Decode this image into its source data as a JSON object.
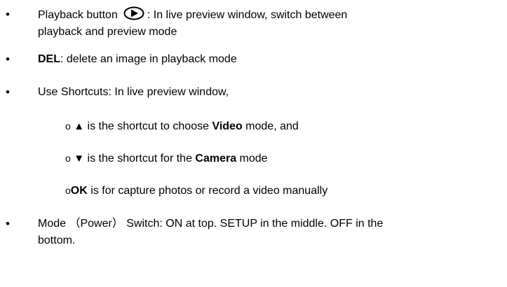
{
  "bullet_char": "•",
  "sub_marker": "o",
  "items": {
    "playback": {
      "label": "Playback button",
      "text_after_icon": ": In live preview window, switch between",
      "line2": "playback and preview mode",
      "icon": "play-in-eye-icon"
    },
    "del": {
      "key": "DEL",
      "text": ": delete an image in playback mode"
    },
    "shortcuts": {
      "text": "Use Shortcuts: In live preview window,",
      "sub": [
        {
          "arrow": "▲",
          "pre": " is the shortcut to choose ",
          "bold": "Video",
          "post": " mode, and"
        },
        {
          "arrow": "▼",
          "pre": " is the shortcut for the ",
          "bold": "Camera",
          "post": " mode"
        },
        {
          "bold": "OK",
          "post": " is for capture photos or record a video manually"
        }
      ]
    },
    "mode": {
      "line1": "Mode （Power） Switch: ON at top. SETUP in the middle. OFF in the",
      "line2": "bottom."
    }
  }
}
